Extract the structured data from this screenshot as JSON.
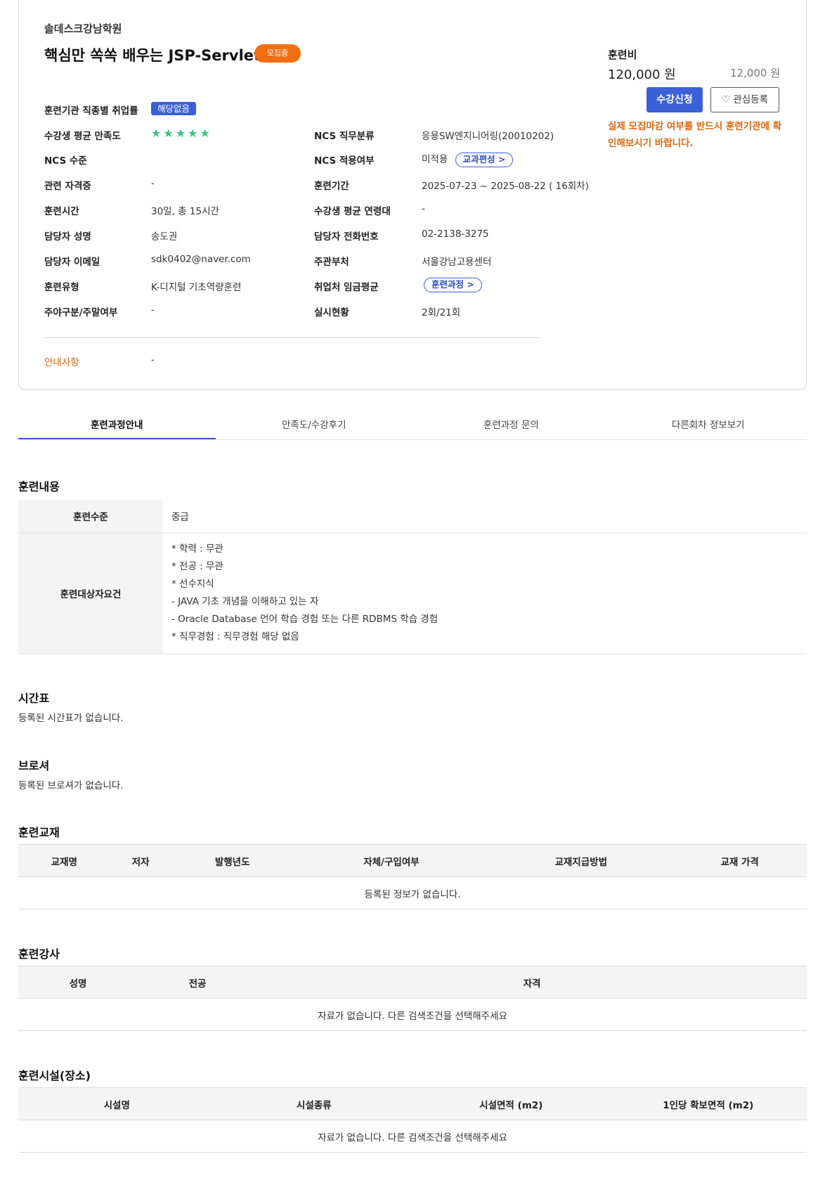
{
  "course": {
    "org": "솔데스크강남학원",
    "title": "핵심만 쏙쏙 배우는 JSP-Servlet",
    "status_badge": "모집중",
    "employment_rate_label": "훈련기관 직종별 취업률",
    "employment_rate_value": "해당없음",
    "satisfaction_label": "수강생 평균 만족도",
    "satisfaction_stars": "★★★★★",
    "ncs_job_label": "NCS 직무분류",
    "ncs_job_value": "응용SW엔지니어링(20010202)",
    "ncs_level_label": "NCS 수준",
    "ncs_apply_label": "NCS 적용여부",
    "ncs_apply_value": "미적용",
    "curriculum_link": "교과편성 >",
    "cert_label": "관련 자격증",
    "cert_value": "-",
    "period_label": "훈련기간",
    "period_value": "2025-07-23 ~ 2025-08-22 ( 16회차)",
    "hours_label": "훈련시간",
    "hours_value": "30일, 총 15시간",
    "age_label": "수강생 평균 연령대",
    "age_value": "-",
    "manager_label": "담당자 성명",
    "manager_value": "송도권",
    "phone_label": "담당자 전화번호",
    "phone_value": "02-2138-3275",
    "email_label": "담당자 이메일",
    "email_value": "sdk0402@naver.com",
    "dept_label": "주관부처",
    "dept_value": "서울강남고용센터",
    "type_label": "훈련유형",
    "type_value": "K-디지털 기초역량훈련",
    "wage_label": "취업처 임금평균",
    "wage_link": "훈련과정 >",
    "daynight_label": "주야구분/주말여부",
    "daynight_value": "-",
    "status_label": "실시현황",
    "status_value": "2회/21회",
    "notice_label": "안내사항",
    "notice_value": "-"
  },
  "fee": {
    "label": "훈련비",
    "main": "120,000 원",
    "sub": "12,000 원",
    "apply_button": "수강신청",
    "favorite_button": "♡ 관심등록",
    "notice": "실제 모집마감 여부를 반드시 훈련기관에 확인해보시기 바랍니다."
  },
  "tabs": [
    "훈련과정안내",
    "만족도/수강후기",
    "훈련과정 문의",
    "다른회차 정보보기"
  ],
  "content": {
    "heading": "훈련내용",
    "level_label": "훈련수준",
    "level_value": "중급",
    "target_label": "훈련대상자요건",
    "target_lines": [
      "* 학력 : 무관",
      "* 전공 : 무관",
      "* 선수지식",
      "- JAVA 기초 개념을 이해하고 있는 자",
      "- Oracle Database 언어 학습 경험 또는 다른 RDBMS 학습 경험",
      "* 직무경험 : 직무경험 해당 없음"
    ]
  },
  "timetable": {
    "heading": "시간표",
    "text": "등록된 시간표가 없습니다."
  },
  "brochure": {
    "heading": "브로셔",
    "text": "등록된 브로셔가 없습니다."
  },
  "textbook": {
    "heading": "훈련교재",
    "columns": [
      "교재명",
      "저자",
      "발행년도",
      "자체/구입여부",
      "교재지급방법",
      "교재 가격"
    ],
    "empty": "등록된 정보가 없습니다."
  },
  "instructor": {
    "heading": "훈련강사",
    "columns": [
      "성명",
      "전공",
      "자격"
    ],
    "empty": "자료가 없습니다. 다른 검색조건을 선택해주세요"
  },
  "facility": {
    "heading": "훈련시설(장소)",
    "columns": [
      "시설명",
      "시설종류",
      "시설면적 (m2)",
      "1인당 확보면적 (m2)"
    ],
    "empty": "자료가 없습니다. 다른 검색조건을 선택해주세요"
  }
}
